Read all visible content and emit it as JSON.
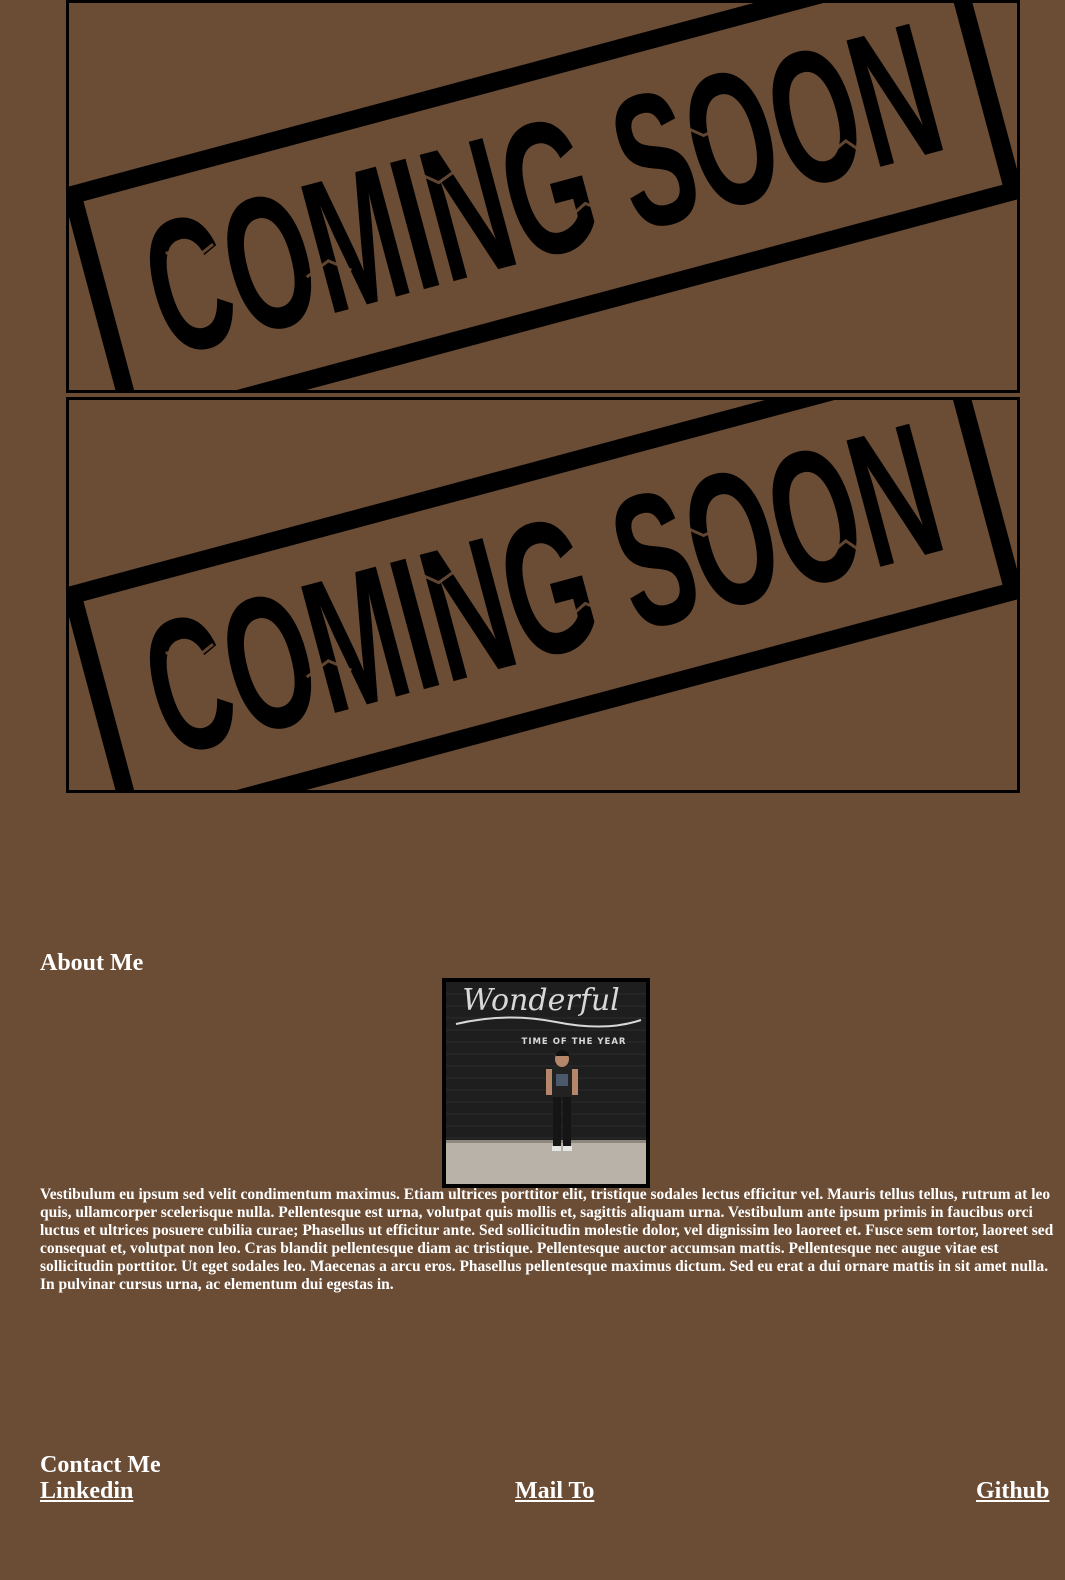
{
  "projects": [
    {
      "stamp_text": "COMING SOON"
    },
    {
      "stamp_text": "COMING SOON"
    }
  ],
  "about": {
    "title": "About Me",
    "photo_sign_script": "Wonderful",
    "photo_sign_caption": "TIME OF THE YEAR",
    "body": "Vestibulum eu ipsum sed velit condimentum maximus. Etiam ultrices porttitor elit, tristique sodales lectus efficitur vel. Mauris tellus tellus, rutrum at leo quis, ullamcorper scelerisque nulla. Pellentesque est urna, volutpat quis mollis et, sagittis aliquam urna. Vestibulum ante ipsum primis in faucibus orci luctus et ultrices posuere cubilia curae; Phasellus ut efficitur ante. Sed sollicitudin molestie dolor, vel dignissim leo laoreet et. Fusce sem tortor, laoreet sed consequat et, volutpat non leo. Cras blandit pellentesque diam ac tristique. Pellentesque auctor accumsan mattis. Pellentesque nec augue vitae est sollicitudin porttitor. Ut eget sodales leo. Maecenas a arcu eros. Phasellus pellentesque maximus dictum. Sed eu erat a dui ornare mattis in sit amet nulla. In pulvinar cursus urna, ac elementum dui egestas in."
  },
  "contact": {
    "title": "Contact Me",
    "links": {
      "linkedin": "Linkedin",
      "mail": "Mail To",
      "github": "Github"
    }
  },
  "colors": {
    "background": "#6b4c35",
    "stamp": "#000000",
    "text": "#ffffff"
  }
}
